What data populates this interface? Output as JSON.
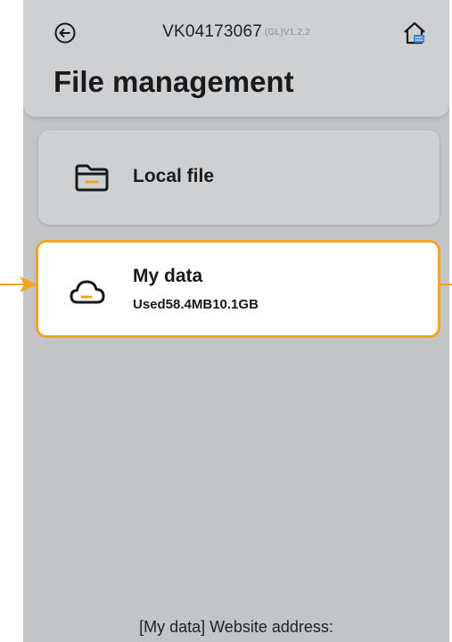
{
  "header": {
    "device_code": "VK04173067",
    "version": "(GL)V1.2.2",
    "page_title": "File management",
    "back_icon": "circle-arrow-left-icon",
    "home_icon": "home-icon"
  },
  "cards": {
    "local_file": {
      "label": "Local file",
      "icon": "folder-icon"
    },
    "my_data": {
      "label": "My data",
      "usage": "Used58.4MB10.1GB",
      "icon": "cloud-icon"
    }
  },
  "footer": {
    "website_label": "[My data] Website address:"
  },
  "colors": {
    "accent": "#f3a425",
    "screen_bg": "#c3c4c6",
    "panel_bg": "#cfd0d2",
    "highlight_card_bg": "#ffffff",
    "text": "#1a1a1a"
  }
}
